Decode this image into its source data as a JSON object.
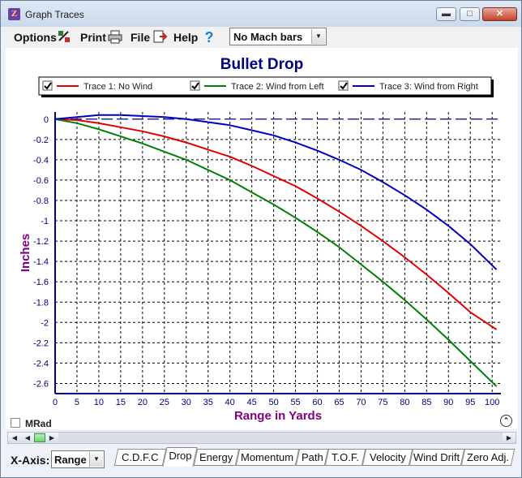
{
  "window": {
    "title": "Graph Traces",
    "app_icon": "app-logo-icon",
    "controls": [
      "minimize-icon",
      "maximize-icon",
      "close-icon"
    ]
  },
  "menubar": {
    "items": [
      {
        "label": "Options",
        "icon": "options-icon"
      },
      {
        "label": "Print",
        "icon": "printer-icon"
      },
      {
        "label": "File",
        "icon": "file-icon"
      },
      {
        "label": "Help",
        "icon": "help-icon"
      }
    ],
    "mach_select": {
      "value": "No Mach bars"
    }
  },
  "chart_data": {
    "type": "line",
    "title": "Bullet Drop",
    "xlabel": "Range in Yards",
    "ylabel": "Inches",
    "xlim": [
      0,
      102
    ],
    "ylim": [
      -2.7,
      0.07
    ],
    "grid": true,
    "legend_position": "top",
    "x_ticks": [
      0,
      5,
      10,
      15,
      20,
      25,
      30,
      35,
      40,
      45,
      50,
      55,
      60,
      65,
      70,
      75,
      80,
      85,
      90,
      95,
      100
    ],
    "y_ticks": [
      0,
      -0.2,
      -0.4,
      -0.6,
      -0.8,
      -1,
      -1.2,
      -1.4,
      -1.6,
      -1.8,
      -2,
      -2.2,
      -2.4,
      -2.6
    ],
    "reference_line": {
      "y": 0,
      "style": "dashed",
      "color": "#000080"
    },
    "x": [
      0,
      5,
      10,
      15,
      20,
      25,
      30,
      35,
      40,
      45,
      50,
      55,
      60,
      65,
      70,
      75,
      80,
      85,
      90,
      95,
      101
    ],
    "series": [
      {
        "name": "Trace 1: No Wind",
        "color": "#e00000",
        "checked": true,
        "values": [
          0,
          -0.01,
          -0.04,
          -0.08,
          -0.12,
          -0.17,
          -0.23,
          -0.3,
          -0.37,
          -0.46,
          -0.56,
          -0.66,
          -0.78,
          -0.91,
          -1.05,
          -1.2,
          -1.36,
          -1.53,
          -1.71,
          -1.9,
          -2.07
        ]
      },
      {
        "name": "Trace 2: Wind from Left",
        "color": "#008000",
        "checked": true,
        "values": [
          0,
          -0.04,
          -0.1,
          -0.17,
          -0.24,
          -0.32,
          -0.4,
          -0.5,
          -0.6,
          -0.72,
          -0.84,
          -0.97,
          -1.11,
          -1.26,
          -1.43,
          -1.6,
          -1.78,
          -1.97,
          -2.17,
          -2.38,
          -2.63
        ]
      },
      {
        "name": "Trace 3: Wind from Right",
        "color": "#0000c0",
        "checked": true,
        "values": [
          0,
          0.02,
          0.04,
          0.04,
          0.03,
          0.02,
          0.0,
          -0.03,
          -0.06,
          -0.11,
          -0.16,
          -0.23,
          -0.31,
          -0.4,
          -0.5,
          -0.62,
          -0.75,
          -0.89,
          -1.05,
          -1.23,
          -1.48
        ]
      }
    ]
  },
  "footer": {
    "mrad_label": "MRad",
    "mrad_checked": false,
    "xaxis_label": "X-Axis:",
    "xaxis_value": "Range",
    "tabs": [
      {
        "label": "C.D.F.C",
        "active": false
      },
      {
        "label": "Drop",
        "active": true
      },
      {
        "label": "Energy",
        "active": false
      },
      {
        "label": "Momentum",
        "active": false
      },
      {
        "label": "Path",
        "active": false
      },
      {
        "label": "T.O.F.",
        "active": false
      },
      {
        "label": "Velocity",
        "active": false
      },
      {
        "label": "Wind Drift",
        "active": false
      },
      {
        "label": "Zero Adj.",
        "active": false
      }
    ]
  },
  "colors": {
    "title": "#000080",
    "axis_label": "#800080",
    "tick_label": "#000080",
    "axis": "#000080"
  }
}
